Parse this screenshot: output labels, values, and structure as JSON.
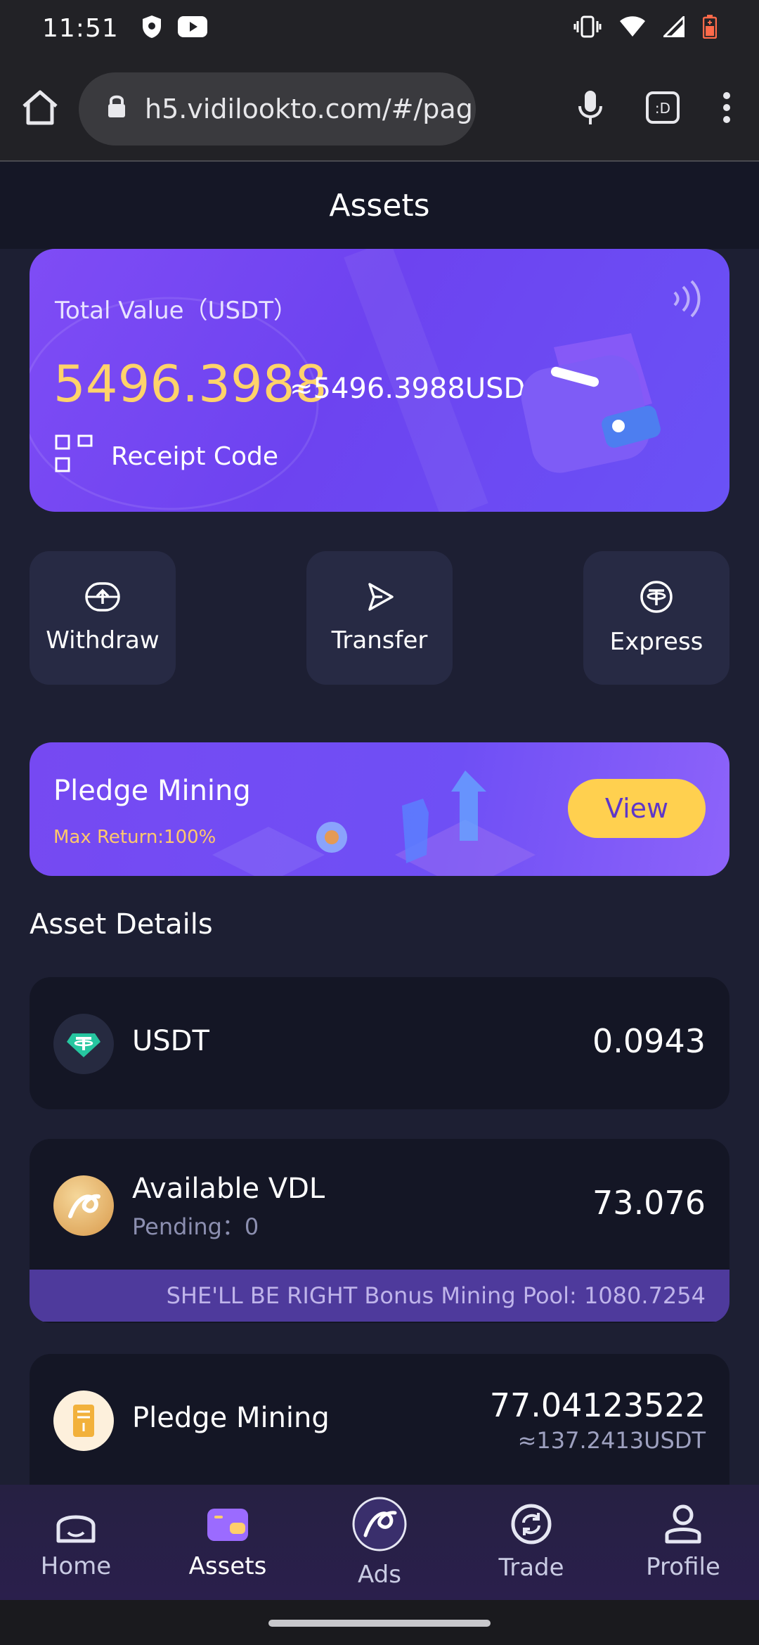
{
  "status": {
    "time": "11:51"
  },
  "browser": {
    "url": "h5.vidilookto.com/#/pag"
  },
  "page": {
    "title": "Assets"
  },
  "total_card": {
    "label": "Total Value（USDT）",
    "value": "5496.3988",
    "approx": "≈5496.3988USD",
    "receipt": "Receipt Code"
  },
  "actions": [
    {
      "label": "Withdraw",
      "icon": "withdraw-icon"
    },
    {
      "label": "Transfer",
      "icon": "transfer-icon"
    },
    {
      "label": "Express",
      "icon": "tether-icon"
    }
  ],
  "banner": {
    "title": "Pledge Mining",
    "subtitle": "Max Return:100%",
    "button": "View"
  },
  "section_title": "Asset Details",
  "assets": {
    "usdt": {
      "name": "USDT",
      "value": "0.0943"
    },
    "vdl": {
      "name": "Available VDL",
      "pending": "Pending：0",
      "value": "73.076",
      "pool": "SHE'LL BE RIGHT Bonus Mining Pool: 1080.7254"
    },
    "pledge": {
      "name": "Pledge Mining",
      "value": "77.04123522",
      "approx": "≈137.2413USDT"
    }
  },
  "tabs": [
    {
      "label": "Home",
      "icon": "home-icon",
      "active": false
    },
    {
      "label": "Assets",
      "icon": "wallet-icon",
      "active": true
    },
    {
      "label": "Ads",
      "icon": "ads-logo-icon",
      "active": false
    },
    {
      "label": "Trade",
      "icon": "refresh-icon",
      "active": false
    },
    {
      "label": "Profile",
      "icon": "person-icon",
      "active": false
    }
  ],
  "colors": {
    "accent_purple": "#7049f2",
    "gold": "#ffd36a",
    "background": "#1d1f33",
    "card": "#141625"
  }
}
